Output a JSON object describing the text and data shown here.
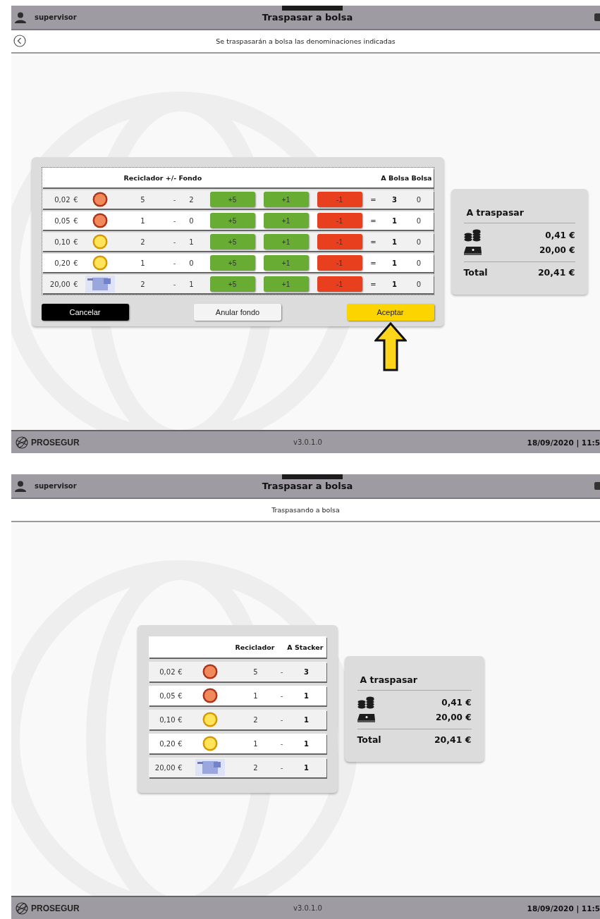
{
  "screens": [
    {
      "kind": "adjust",
      "user": "supervisor",
      "title": "Traspasar a bolsa",
      "back_button": true,
      "message": "Se traspasarán a bolsa las denominaciones indicadas",
      "table": {
        "headers": [
          "Reciclador +/- Fondo",
          "A Bolsa Bolsa"
        ],
        "rows": [
          {
            "amount": "0,02",
            "currency": "€",
            "kind": "copper",
            "recycler": "5",
            "minus": "-",
            "fund": "2",
            "adjust": [
              {
                "label": "+5",
                "kind": "add"
              },
              {
                "label": "+1",
                "kind": "add"
              },
              {
                "label": "-1",
                "kind": "subtract"
              }
            ],
            "equals": "=",
            "result": "3",
            "bag": "0"
          },
          {
            "amount": "0,05",
            "currency": "€",
            "kind": "copper",
            "recycler": "1",
            "minus": "-",
            "fund": "0",
            "adjust": [
              {
                "label": "+5",
                "kind": "add"
              },
              {
                "label": "+1",
                "kind": "add"
              },
              {
                "label": "-1",
                "kind": "subtract"
              }
            ],
            "equals": "=",
            "result": "1",
            "bag": "0"
          },
          {
            "amount": "0,10",
            "currency": "€",
            "kind": "gold",
            "recycler": "2",
            "minus": "-",
            "fund": "1",
            "adjust": [
              {
                "label": "+5",
                "kind": "add"
              },
              {
                "label": "+1",
                "kind": "add"
              },
              {
                "label": "-1",
                "kind": "subtract"
              }
            ],
            "equals": "=",
            "result": "1",
            "bag": "0"
          },
          {
            "amount": "0,20",
            "currency": "€",
            "kind": "gold",
            "recycler": "1",
            "minus": "-",
            "fund": "0",
            "adjust": [
              {
                "label": "+5",
                "kind": "add"
              },
              {
                "label": "+1",
                "kind": "add"
              },
              {
                "label": "-1",
                "kind": "subtract"
              }
            ],
            "equals": "=",
            "result": "1",
            "bag": "0"
          },
          {
            "amount": "20,00",
            "currency": "€",
            "kind": "note",
            "recycler": "2",
            "minus": "-",
            "fund": "1",
            "adjust": [
              {
                "label": "+5",
                "kind": "add"
              },
              {
                "label": "+1",
                "kind": "add"
              },
              {
                "label": "-1",
                "kind": "subtract"
              }
            ],
            "equals": "=",
            "result": "1",
            "bag": "0"
          }
        ]
      },
      "actions": [
        {
          "label": "Cancelar",
          "kind": "cancel"
        },
        {
          "label": "Anular fondo",
          "kind": "neutral"
        },
        {
          "label": "Aceptar",
          "kind": "accept"
        }
      ],
      "pointer_arrow": true,
      "summary": {
        "title": "A traspasar",
        "items": [
          {
            "kind": "coins",
            "value": "0,41 €"
          },
          {
            "kind": "notes",
            "value": "20,00 €"
          }
        ],
        "total_label": "Total",
        "total_value": "20,41 €"
      },
      "footer": {
        "brand": "PROSEGUR",
        "version": "v3.0.1.0",
        "datetime": "18/09/2020 | 11:5"
      }
    },
    {
      "kind": "progress",
      "user": "supervisor",
      "title": "Traspasar a bolsa",
      "message": "Traspasando a bolsa",
      "table": {
        "headers": [
          "Reciclador",
          "A Stacker"
        ],
        "rows": [
          {
            "amount": "0,02",
            "currency": "€",
            "kind": "copper",
            "recycler": "5",
            "minus": "-",
            "result": "3"
          },
          {
            "amount": "0,05",
            "currency": "€",
            "kind": "copper",
            "recycler": "1",
            "minus": "-",
            "result": "1"
          },
          {
            "amount": "0,10",
            "currency": "€",
            "kind": "gold",
            "recycler": "2",
            "minus": "-",
            "result": "1"
          },
          {
            "amount": "0,20",
            "currency": "€",
            "kind": "gold",
            "recycler": "1",
            "minus": "-",
            "result": "1"
          },
          {
            "amount": "20,00",
            "currency": "€",
            "kind": "note",
            "recycler": "2",
            "minus": "-",
            "result": "1"
          }
        ]
      },
      "summary": {
        "title": "A traspasar",
        "items": [
          {
            "kind": "coins",
            "value": "0,41 €"
          },
          {
            "kind": "notes",
            "value": "20,00 €"
          }
        ],
        "total_label": "Total",
        "total_value": "20,41 €"
      },
      "footer": {
        "brand": "PROSEGUR",
        "version": "v3.0.1.0",
        "datetime": "18/09/2020 | 11:5"
      }
    }
  ]
}
